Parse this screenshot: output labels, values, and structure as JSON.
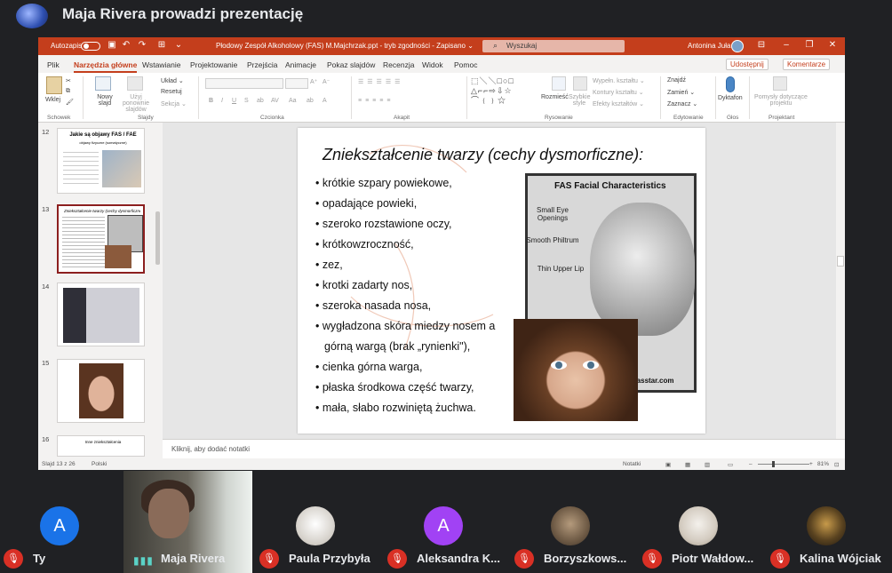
{
  "meet": {
    "title": "Maja Rivera prowadzi prezentację"
  },
  "app": {
    "autosave_label": "Autozapis",
    "doc_title": "Płodowy Zespół Alkoholowy (FAS) M.Majchrzak.ppt  -  tryb zgodności  -  Zapisano ⌄",
    "search_placeholder": "Wyszukaj",
    "user": "Antonina Juła"
  },
  "tabs": [
    "Plik",
    "Narzędzia główne",
    "Wstawianie",
    "Projektowanie",
    "Przejścia",
    "Animacje",
    "Pokaz slajdów",
    "Recenzja",
    "Widok",
    "Pomoc"
  ],
  "share_label": "Udostępnij",
  "comments_label": "Komentarze",
  "ribbon": {
    "paste": "Wklej",
    "new_slide": "Nowy slajd",
    "reuse": "Użyj ponownie slajdów",
    "layout": "Układ ⌄",
    "reset": "Resetuj",
    "section": "Sekcja ⌄",
    "arrange": "Rozmieść",
    "quick_styles": "Szybkie style",
    "fill": "Wypełn. kształtu ⌄",
    "outline": "Kontury kształtu ⌄",
    "effects": "Efekty kształtów ⌄",
    "find": "Znajdź",
    "replace": "Zamień ⌄",
    "select": "Zaznacz ⌄",
    "dictate": "Dyktafon",
    "designer": "Pomysły dotyczące projektu",
    "groups": [
      "Schowek",
      "Slajdy",
      "Czcionka",
      "Akapit",
      "Rysowanie",
      "Edytowanie",
      "Głos",
      "Projektant"
    ]
  },
  "thumbnails": [
    {
      "num": "12",
      "title": "Jakie są objawy FAS / FAE",
      "subtitle": "objawy fizyczne (somatyczne)"
    },
    {
      "num": "13",
      "title": "Zniekształcenie twarzy (cechy dysmorficzne)"
    },
    {
      "num": "14"
    },
    {
      "num": "15"
    },
    {
      "num": "16",
      "title": "Inne zniekształcenia"
    }
  ],
  "slide": {
    "title": "Zniekształcenie twarzy (cechy dysmorficzne):",
    "bullets": [
      "• krótkie szpary powiekowe,",
      "• opadające powieki,",
      "• szeroko rozstawione oczy,",
      "• krótkowzroczność,",
      "• zez,",
      "• krotki zadarty nos,",
      "• szeroka nasada nosa,",
      "• wygładzona skóra miedzy nosem a",
      "górną wargą (brak „rynienki\"),",
      "• cienka górna warga,",
      "• płaska środkowa część twarzy,",
      "• mała, słabo rozwiniętą żuchwa."
    ],
    "fas": {
      "heading": "FAS Facial Characteristics",
      "label1": "Small Eye Openings",
      "label2": "Smooth Philtrum",
      "label3": "Thin Upper Lip",
      "url": "fasstar.com"
    }
  },
  "notes_placeholder": "Kliknij, aby dodać notatki",
  "status": {
    "slide": "Slajd 13 z 26",
    "lang": "Polski",
    "notes": "Notatki",
    "zoom": "81%"
  },
  "participants": [
    {
      "name": "Ty",
      "initial": "A",
      "color": "#1a73e8"
    },
    {
      "name": "Maja Rivera"
    },
    {
      "name": "Paula Przybyła"
    },
    {
      "name": "Aleksandra K...",
      "initial": "A",
      "color": "#a142f4"
    },
    {
      "name": "Borzyszkows..."
    },
    {
      "name": "Piotr Wałdow..."
    },
    {
      "name": "Kalina Wójciak"
    }
  ]
}
